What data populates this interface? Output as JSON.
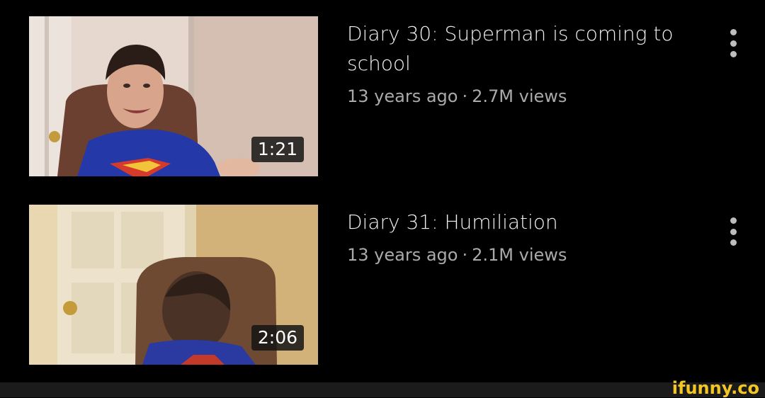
{
  "videos": [
    {
      "title": "Diary 30: Superman is coming to school",
      "age": "13 years ago",
      "views": "2.7M views",
      "duration": "1:21"
    },
    {
      "title": "Diary 31: Humiliation",
      "age": "13 years ago",
      "views": "2.1M views",
      "duration": "2:06"
    }
  ],
  "separator": "·",
  "watermark": "ifunny.co",
  "colors": {
    "background": "#000000",
    "title_text": "#f1f1f1",
    "meta_text": "#aaaaaa",
    "brand": "#f3c623"
  }
}
